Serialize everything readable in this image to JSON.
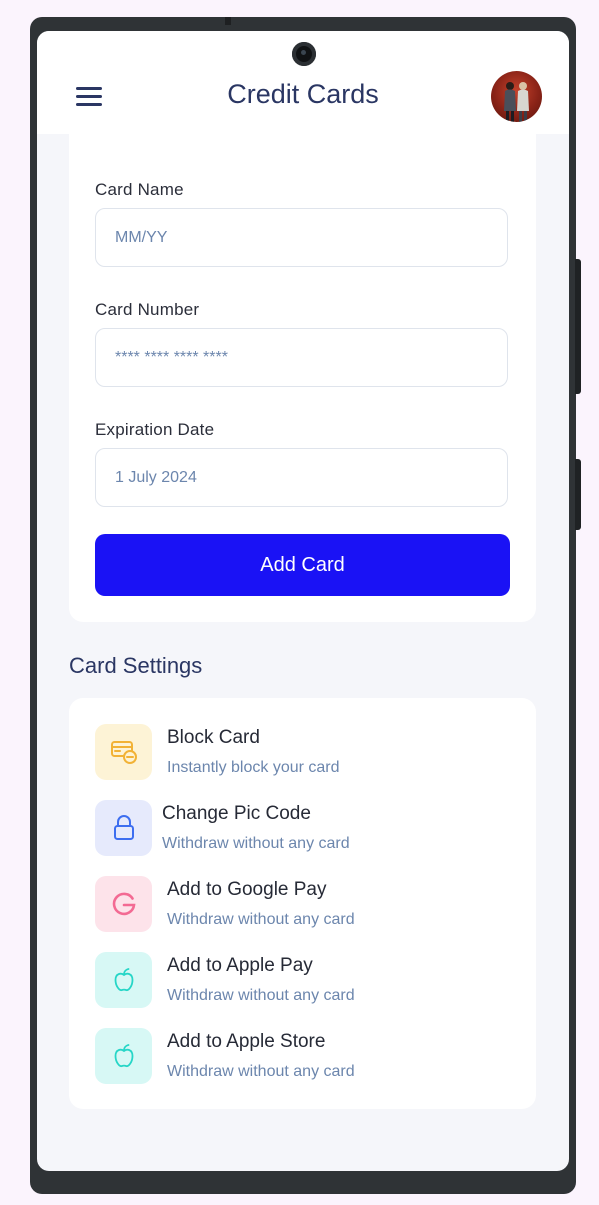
{
  "header": {
    "title": "Credit Cards",
    "menu_icon": "hamburger-menu-icon",
    "avatar_icon": "user-avatar"
  },
  "form": {
    "card_name_label": "Card Name",
    "card_name_placeholder": "MM/YY",
    "card_number_label": "Card Number",
    "card_number_placeholder": "**** **** **** ****",
    "expiration_label": "Expiration Date",
    "expiration_value": "1 July 2024",
    "submit_label": "Add Card"
  },
  "settings": {
    "title": "Card Settings",
    "items": [
      {
        "title": "Block Card",
        "subtitle": "Instantly block your card",
        "icon": "block-card-icon",
        "bg": "#fdf3d6",
        "color": "#f2b236"
      },
      {
        "title": "Change Pic Code",
        "subtitle": "Withdraw without any card",
        "icon": "lock-icon",
        "bg": "#e6eafc",
        "color": "#3d6ef0"
      },
      {
        "title": "Add to Google Pay",
        "subtitle": "Withdraw without any card",
        "icon": "google-icon",
        "bg": "#fde3ea",
        "color": "#f36a93"
      },
      {
        "title": "Add to Apple Pay",
        "subtitle": "Withdraw without any card",
        "icon": "apple-icon",
        "bg": "#d7f8f5",
        "color": "#26d6c7"
      },
      {
        "title": "Add to Apple Store",
        "subtitle": "Withdraw without any card",
        "icon": "apple-icon",
        "bg": "#d7f8f5",
        "color": "#26d6c7"
      }
    ]
  },
  "colors": {
    "primary": "#1a12f5",
    "heading": "#2a3663",
    "muted_text": "#6c86ad",
    "screen_background": "#f5f6fa"
  }
}
